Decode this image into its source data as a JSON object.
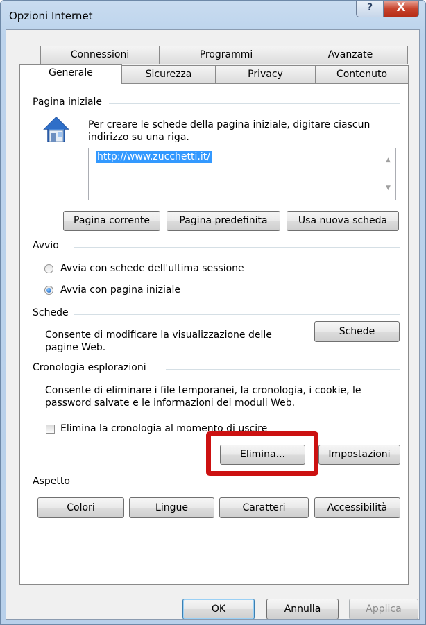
{
  "window": {
    "title": "Opzioni Internet"
  },
  "titlebar": {
    "help_glyph": "?",
    "close_glyph": "X"
  },
  "tabs": {
    "row1": [
      "Connessioni",
      "Programmi",
      "Avanzate"
    ],
    "row2": [
      "Generale",
      "Sicurezza",
      "Privacy",
      "Contenuto"
    ],
    "active": "Generale"
  },
  "home": {
    "section": "Pagina iniziale",
    "desc_line1": "Per creare le schede della pagina iniziale, digitare ciascun",
    "desc_line2": "indirizzo su una riga.",
    "url": "http://www.zucchetti.it/",
    "btn_current": "Pagina corrente",
    "btn_default": "Pagina predefinita",
    "btn_new_tab": "Usa nuova scheda"
  },
  "startup": {
    "section": "Avvio",
    "option_last_session": "Avvia con schede dell'ultima sessione",
    "option_home": "Avvia con pagina iniziale",
    "selected": "option_home"
  },
  "tabs_section": {
    "section": "Schede",
    "desc_line1": "Consente di modificare la visualizzazione delle",
    "desc_line2": "pagine Web.",
    "button": "Schede"
  },
  "history": {
    "section": "Cronologia esplorazioni",
    "desc_line1": "Consente di eliminare i file temporanei, la cronologia, i cookie, le",
    "desc_line2": "password salvate e le informazioni dei moduli Web.",
    "checkbox_label": "Elimina la cronologia al momento di uscire",
    "checkbox_checked": false,
    "btn_delete": "Elimina...",
    "btn_settings": "Impostazioni"
  },
  "appearance": {
    "section": "Aspetto",
    "btn_colors": "Colori",
    "btn_languages": "Lingue",
    "btn_fonts": "Caratteri",
    "btn_accessibility": "Accessibilità"
  },
  "footer": {
    "ok": "OK",
    "cancel": "Annulla",
    "apply": "Applica"
  },
  "colors": {
    "highlight": "#cc1111",
    "selection": "#3399ff",
    "title_bar": "#bcd3ec"
  }
}
